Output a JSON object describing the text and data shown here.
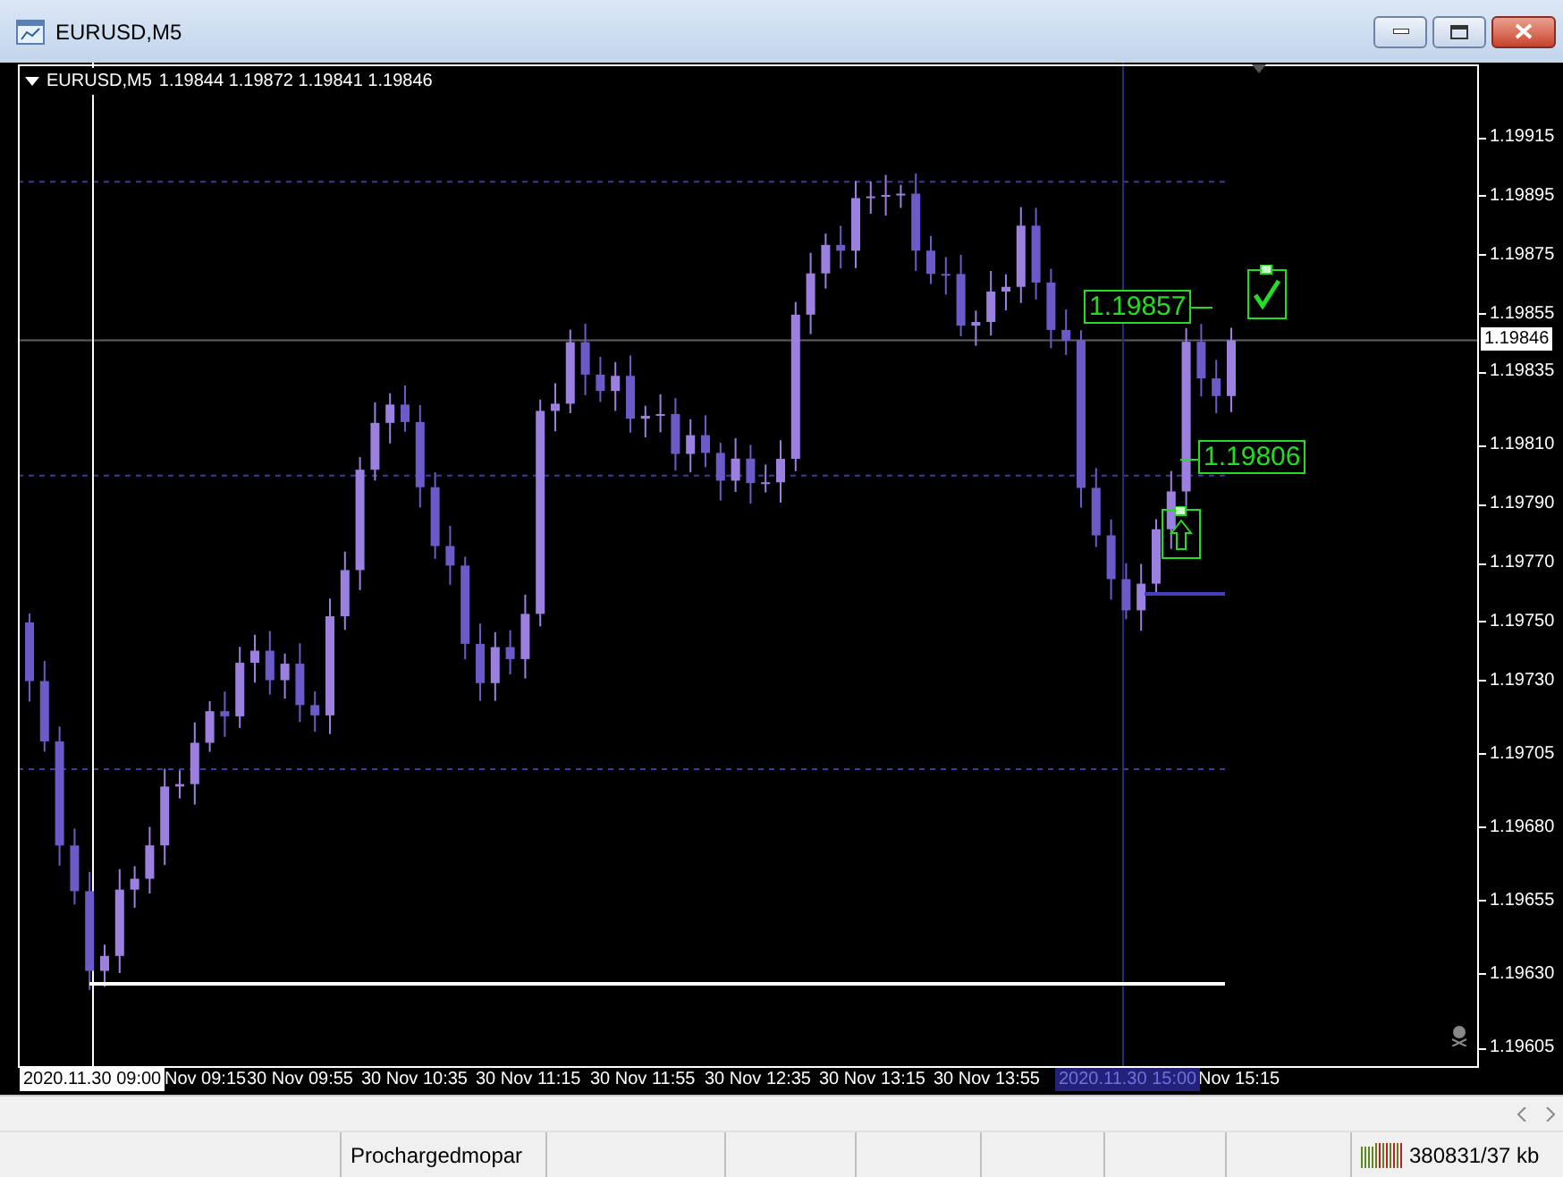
{
  "window": {
    "title": "EURUSD,M5"
  },
  "chart": {
    "symbol": "EURUSD,M5",
    "quote": "1.19844 1.19872 1.19841 1.19846",
    "price_labels": [
      "1.19915",
      "1.19895",
      "1.19875",
      "1.19855",
      "1.19835",
      "1.19810",
      "1.19790",
      "1.19770",
      "1.19750",
      "1.19730",
      "1.19705",
      "1.19680",
      "1.19655",
      "1.19630",
      "1.19605"
    ],
    "current_price": "1.19846",
    "cursor_time": "2020.11.30 09:00",
    "time_labels": [
      "Nov 09:15",
      "30 Nov 09:55",
      "30 Nov 10:35",
      "30 Nov 11:15",
      "30 Nov 11:55",
      "30 Nov 12:35",
      "30 Nov 13:15",
      "30 Nov 13:55",
      "Nov 15:15"
    ],
    "crosshair_time": "2020.11.30 15:00",
    "markers": [
      {
        "kind": "price",
        "text": "1.19857"
      },
      {
        "kind": "price",
        "text": "1.19806"
      },
      {
        "kind": "arrow_up"
      },
      {
        "kind": "check"
      }
    ]
  },
  "status_bar": {
    "account": "Prochargedmopar",
    "traffic": "380831/37 kb"
  }
}
